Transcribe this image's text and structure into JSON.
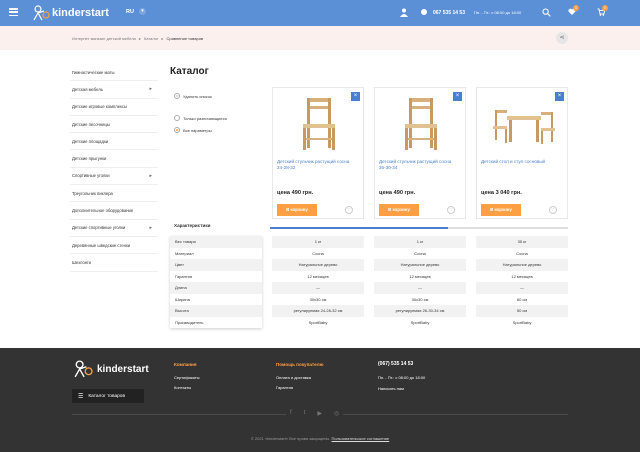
{
  "header": {
    "brand": "kinderstart",
    "lang": "RU",
    "phone": "067 535 14 53",
    "hours": "Пн. - Пт.: с 08:00 до 18:00",
    "wishlist_count": "0",
    "cart_count": "0"
  },
  "breadcrumbs": [
    "Интернет магазин детской мебели",
    "Каталог",
    "Сравнение товаров"
  ],
  "sidebar": {
    "items": [
      {
        "label": "Гимнастические маты",
        "chevron": false
      },
      {
        "label": "Детская мебель",
        "chevron": true
      },
      {
        "label": "Детские игровые комплексы",
        "chevron": false
      },
      {
        "label": "Детские песочницы",
        "chevron": false
      },
      {
        "label": "Детские площадки",
        "chevron": false
      },
      {
        "label": "Детские прыгунки",
        "chevron": false
      },
      {
        "label": "Спортивные уголки",
        "chevron": true
      },
      {
        "label": "Треугольник пиклера",
        "chevron": false
      },
      {
        "label": "Дополнительное оборудование",
        "chevron": false
      },
      {
        "label": "Детские спортивные уголки",
        "chevron": true
      },
      {
        "label": "Деревянные шведские стенки",
        "chevron": false
      },
      {
        "label": "Шезлонги",
        "chevron": false
      }
    ]
  },
  "page": {
    "title": "Каталог",
    "remove_list": "Удалить список",
    "only_diff": "Только различающиеся",
    "all_params": "Все параметры",
    "characteristics": "Характеристики"
  },
  "products": [
    {
      "name": "Детский стульчик растущий сосна 24-28-32",
      "price": "цена 490 грн.",
      "buy": "В корзину"
    },
    {
      "name": "Детский стульчик растущий сосна 26-30-34",
      "price": "цена 490 грн.",
      "buy": "В корзину"
    },
    {
      "name": "Детский стол и стул сосновый",
      "price": "цена 3 040 грн.",
      "buy": "В корзину"
    }
  ],
  "attributes": [
    "Вес товара",
    "Материал",
    "Цвет",
    "Гарантия",
    "Длина",
    "Ширина",
    "Высота",
    "Производитель"
  ],
  "values": [
    [
      "1 кг",
      "Сосна",
      "Натуральное дерево",
      "12 месяцев",
      "—",
      "30х30 см",
      "регулируемая 24-28-32 см",
      "SportBaby"
    ],
    [
      "1 кг",
      "Сосна",
      "Натуральное дерево",
      "12 месяцев",
      "—",
      "30х30 см",
      "регулируемая 26-30-34 см",
      "SportBaby"
    ],
    [
      "35 кг",
      "Сосна",
      "Натуральное дерево",
      "12 месяцев",
      "—",
      "60 см",
      "50 см",
      "SportBaby"
    ]
  ],
  "footer": {
    "brand": "kinderstart",
    "catalog_btn": "Каталог товаров",
    "col1": {
      "heading": "Компания",
      "links": [
        "Сертификаты",
        "Контакты"
      ]
    },
    "col2": {
      "heading": "Помощь покупателю",
      "links": [
        "Оплата и доставка",
        "Гарантия"
      ]
    },
    "phone": "(067) 535 14 53",
    "hours": "Пн. - Пт.: с 08:00 до 18:00",
    "write": "Написать нам",
    "copyright": "© 2021 «kinderstart» Все права защищены.",
    "agreement": "Пользовательское соглашение"
  },
  "colors": {
    "accent": "#ff9f43",
    "primary": "#5b8fd6",
    "link": "#4a7fd0"
  }
}
